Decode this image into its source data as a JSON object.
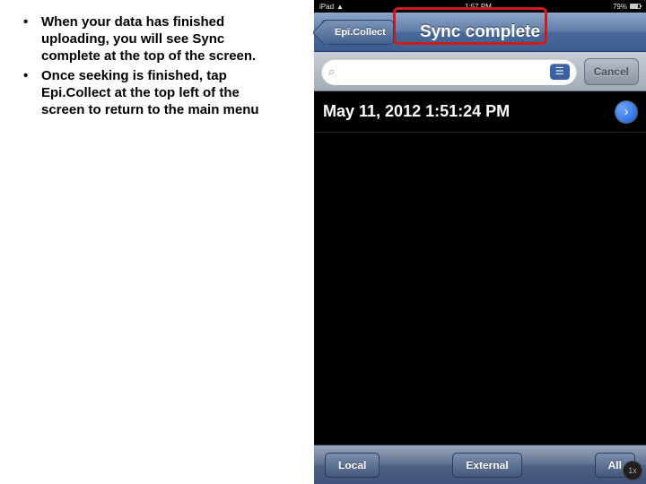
{
  "bullets": {
    "b0": "When your data has finished uploading, you will see Sync complete at the top of the screen.",
    "b1": "Once seeking is finished, tap Epi.Collect at the top left of the screen to return to the main menu"
  },
  "status": {
    "left": "iPad",
    "wifi": "▲",
    "center": "1:57 PM",
    "pct": "79%"
  },
  "nav": {
    "back": "Epi.Collect",
    "title": "Sync complete"
  },
  "search": {
    "placeholder": "",
    "book": "☰",
    "cancel": "Cancel"
  },
  "row": {
    "label": "May 11, 2012 1:51:24 PM",
    "chevron": "›"
  },
  "toolbar": {
    "local": "Local",
    "external": "External",
    "all": "All"
  },
  "onex": "1x",
  "icons": {
    "search": "⌕"
  }
}
